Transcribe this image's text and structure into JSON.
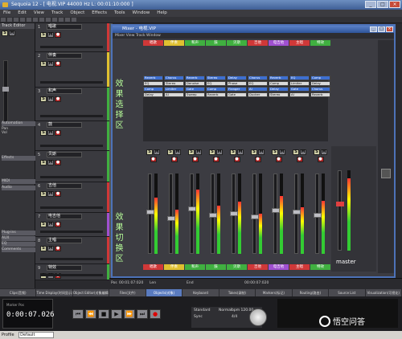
{
  "window": {
    "title": "Sequoia 12 - [ 电视.VIP     44000 Hz L: 00:01:10:000 ]",
    "min": "_",
    "max": "□",
    "close": "×"
  },
  "menu": [
    "File",
    "Edit",
    "View",
    "Track",
    "Object",
    "Effects",
    "Tools",
    "Window",
    "Help"
  ],
  "inspector": {
    "header": "Track Editor",
    "automation": "Automation",
    "fx": "FX",
    "mixer_labels": [
      "Pan",
      "Vol"
    ],
    "sections": [
      "Automation",
      "Effects",
      "MIDI",
      "Audio",
      "Plug-ins",
      "AUX",
      "EQ",
      "Comments"
    ]
  },
  "tracks": [
    {
      "num": "1",
      "name": "唱歌",
      "color": "#d03838"
    },
    {
      "num": "2",
      "name": "伴奏",
      "color": "#e0c030"
    },
    {
      "num": "3",
      "name": "和声",
      "color": "#40b040"
    },
    {
      "num": "4",
      "name": "鼓",
      "color": "#40b040"
    },
    {
      "num": "5",
      "name": "贝斯",
      "color": "#40b040"
    },
    {
      "num": "6",
      "name": "吉他",
      "color": "#d03838"
    },
    {
      "num": "7",
      "name": "电吉他",
      "color": "#a050d0"
    },
    {
      "num": "8",
      "name": "主唱",
      "color": "#d03838"
    },
    {
      "num": "9",
      "name": "特效",
      "color": "#40b040"
    }
  ],
  "mixer": {
    "title": "Mixer - 电视.VIP",
    "menu": "Mixer   View   Track   Window",
    "strips": [
      {
        "name": "唱歌",
        "color": "#d03838"
      },
      {
        "name": "伴奏",
        "color": "#e0c030"
      },
      {
        "name": "和声",
        "color": "#40b040"
      },
      {
        "name": "鼓",
        "color": "#40b040"
      },
      {
        "name": "贝斯",
        "color": "#40b040"
      },
      {
        "name": "吉他",
        "color": "#d03838"
      },
      {
        "name": "电吉他",
        "color": "#a050d0"
      },
      {
        "name": "主唱",
        "color": "#d03838"
      },
      {
        "name": "特效",
        "color": "#40b040"
      }
    ],
    "fx": [
      [
        "Reverb",
        "EQ",
        "Comp",
        "Delay"
      ],
      [
        "Chorus",
        "Stereo",
        "Limiter",
        "AI"
      ],
      [
        "Reverb",
        "Denoise",
        "Gate",
        "Sweep"
      ],
      [
        "Stereo",
        "EQ",
        "Comp",
        "Reverb"
      ],
      [
        "Delay",
        "Phase",
        "Flanger",
        "Gate"
      ],
      [
        "Chorus",
        "EQ",
        "AI",
        "Ducker"
      ],
      [
        "Reverb",
        "Comp",
        "Delay",
        "Stereo"
      ],
      [
        "EQ",
        "Limiter",
        "Gate",
        "AI"
      ],
      [
        "Comp",
        "Delay",
        "Chorus",
        "Reverb"
      ]
    ],
    "fx_label": [
      "效",
      "果",
      "选",
      "择",
      "区"
    ],
    "switch_label": [
      "效",
      "果",
      "切",
      "换",
      "区"
    ],
    "master": "master"
  },
  "bottom": {
    "pos": "Pos",
    "pos_val": "00:01:07:020",
    "len": "Len",
    "end": "End",
    "time": "00:00:07:020"
  },
  "tabs": [
    "Clips(音频)",
    "Time Display(时间显示)",
    "Object Editor(对象编辑器)",
    "Files(文件)",
    "Objects(对象)",
    "Keyboard",
    "Takes(录制)",
    "Markers(标记)",
    "Routing(路由)",
    "Source List",
    "Visualization(可视化)"
  ],
  "active_tab": "Objects(对象)",
  "transport": {
    "clock_label": "Marker  Pos",
    "time": "0:00:07.026",
    "std": "Standard",
    "std_val": "Normal",
    "tempo": "bpm 120.00",
    "sig": "4/4",
    "mode": "Sync"
  },
  "statusbar": {
    "label": "Profile",
    "preset": "Default"
  },
  "watermark": "悟空问答"
}
